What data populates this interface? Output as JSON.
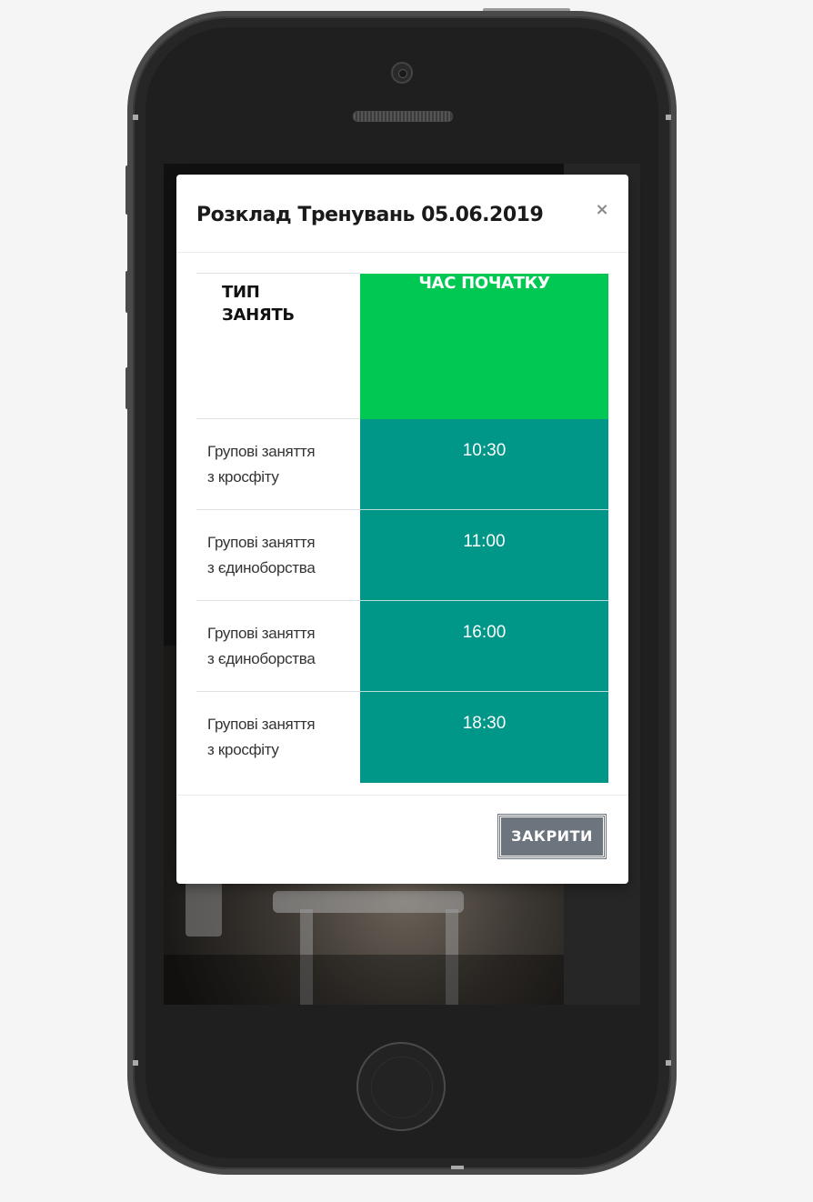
{
  "modal": {
    "title": "Розклад Тренувань 05.06.2019",
    "close_symbol": "×",
    "table": {
      "headers": {
        "type_line1": "ТИП",
        "type_line2": "ЗАНЯТЬ",
        "time": "ЧАС ПОЧАТКУ"
      },
      "rows": [
        {
          "type_line1": "Групові заняття",
          "type_line2": "з кросфіту",
          "time": "10:30"
        },
        {
          "type_line1": "Групові заняття",
          "type_line2": "з єдиноборства",
          "time": "11:00"
        },
        {
          "type_line1": "Групові заняття",
          "type_line2": "з єдиноборства",
          "time": "16:00"
        },
        {
          "type_line1": "Групові заняття",
          "type_line2": "з кросфіту",
          "time": "18:30"
        }
      ]
    },
    "footer": {
      "close_label": "ЗАКРИТИ"
    }
  },
  "colors": {
    "header_time_bg": "#00c853",
    "cell_time_bg": "#009688",
    "close_button_bg": "#6c757d"
  }
}
